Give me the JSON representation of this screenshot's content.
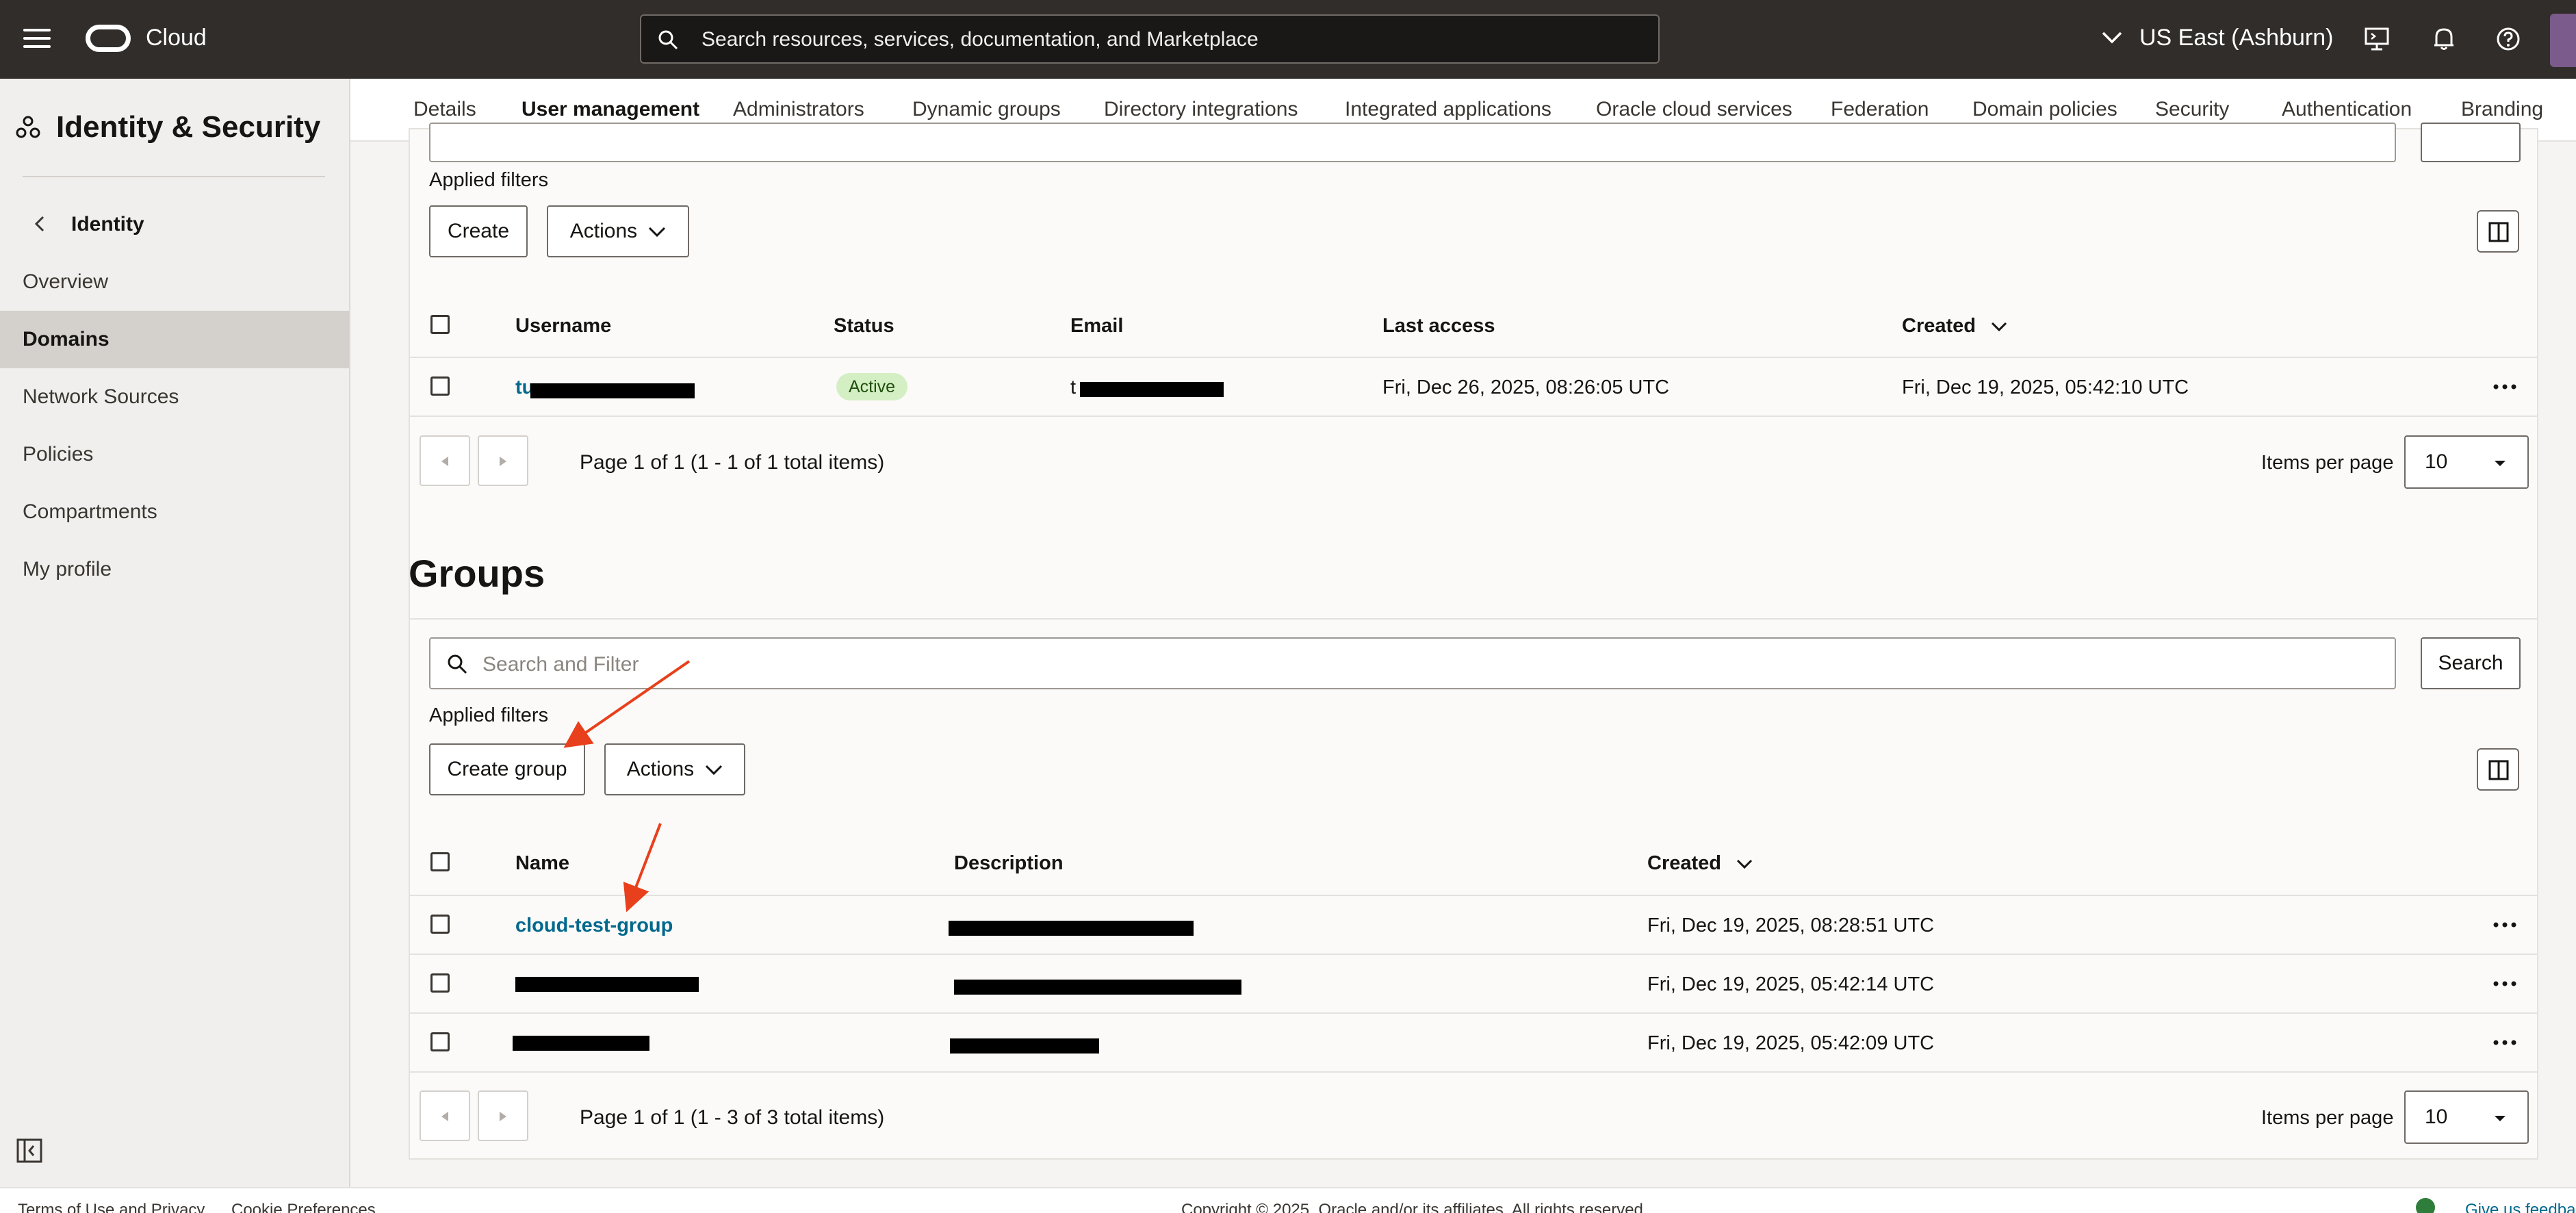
{
  "topbar": {
    "brand": "Cloud",
    "search_placeholder": "Search resources, services, documentation, and Marketplace",
    "region": "US East (Ashburn)"
  },
  "sidebar": {
    "title": "Identity & Security",
    "back_label": "Identity",
    "items": [
      {
        "label": "Overview"
      },
      {
        "label": "Domains",
        "active": true
      },
      {
        "label": "Network Sources"
      },
      {
        "label": "Policies"
      },
      {
        "label": "Compartments"
      },
      {
        "label": "My profile"
      }
    ]
  },
  "tabs": [
    {
      "label": "Details"
    },
    {
      "label": "User management",
      "active": true
    },
    {
      "label": "Administrators"
    },
    {
      "label": "Dynamic groups"
    },
    {
      "label": "Directory integrations"
    },
    {
      "label": "Integrated applications"
    },
    {
      "label": "Oracle cloud services"
    },
    {
      "label": "Federation"
    },
    {
      "label": "Domain policies"
    },
    {
      "label": "Security"
    },
    {
      "label": "Authentication"
    },
    {
      "label": "Branding"
    }
  ],
  "users": {
    "search_placeholder": "Search and Filter",
    "search_button": "Search",
    "applied_filters": "Applied filters",
    "create_button": "Create",
    "actions_button": "Actions",
    "columns": {
      "username": "Username",
      "status": "Status",
      "email": "Email",
      "last_access": "Last access",
      "created": "Created"
    },
    "rows": [
      {
        "username": "tu",
        "status": "Active",
        "email": "t",
        "last_access": "Fri, Dec 26, 2025, 08:26:05 UTC",
        "created": "Fri, Dec 19, 2025, 05:42:10 UTC"
      }
    ],
    "pagination": "Page 1 of 1 (1 - 1 of 1 total items)",
    "items_per_page_label": "Items per page",
    "items_per_page": "10"
  },
  "groups": {
    "title": "Groups",
    "search_placeholder": "Search and Filter",
    "search_button": "Search",
    "applied_filters": "Applied filters",
    "create_button": "Create group",
    "actions_button": "Actions",
    "columns": {
      "name": "Name",
      "description": "Description",
      "created": "Created"
    },
    "rows": [
      {
        "name": "cloud-test-group",
        "created": "Fri, Dec 19, 2025, 08:28:51 UTC"
      },
      {
        "name": "",
        "created": "Fri, Dec 19, 2025, 05:42:14 UTC"
      },
      {
        "name": "",
        "created": "Fri, Dec 19, 2025, 05:42:09 UTC"
      }
    ],
    "pagination": "Page 1 of 1 (1 - 3 of 3 total items)",
    "items_per_page_label": "Items per page",
    "items_per_page": "10"
  },
  "footer": {
    "terms": "Terms of Use and Privacy",
    "cookies": "Cookie Preferences",
    "copyright": "Copyright © 2025, Oracle and/or its affiliates. All rights reserved.",
    "feedback": "Give us feedba"
  },
  "colors": {
    "topbar": "#312d2a",
    "link": "#00688c",
    "annotation_arrow": "#e8401c",
    "active_badge": "#d4efc4"
  }
}
